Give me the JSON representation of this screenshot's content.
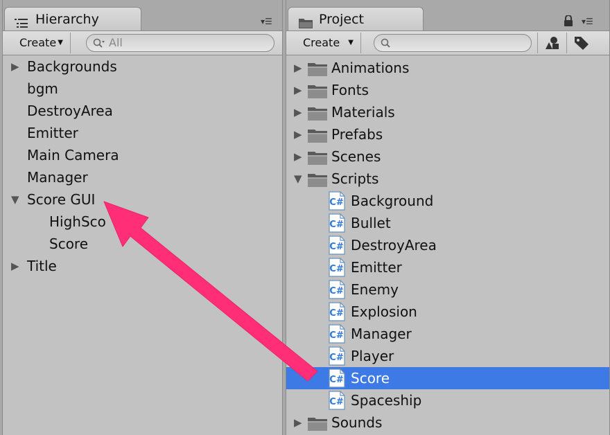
{
  "colors": {
    "selection": "#3e7ae6",
    "arrow": "#ff2e76",
    "panel": "#c2c2c2"
  },
  "hierarchy": {
    "tab_label": "Hierarchy",
    "create_label": "Create",
    "search_placeholder": "All",
    "items": [
      {
        "label": "Backgrounds",
        "expander": "collapsed"
      },
      {
        "label": "bgm",
        "expander": "none"
      },
      {
        "label": "DestroyArea",
        "expander": "none"
      },
      {
        "label": "Emitter",
        "expander": "none"
      },
      {
        "label": "Main Camera",
        "expander": "none"
      },
      {
        "label": "Manager",
        "expander": "none"
      },
      {
        "label": "Score GUI",
        "expander": "expanded"
      },
      {
        "label": "HighSco",
        "expander": "none"
      },
      {
        "label": "Score",
        "expander": "none"
      },
      {
        "label": "Title",
        "expander": "collapsed"
      }
    ]
  },
  "project": {
    "tab_label": "Project",
    "create_label": "Create",
    "search_placeholder": "",
    "folders_top": [
      "Animations",
      "Fonts",
      "Materials",
      "Prefabs",
      "Scenes"
    ],
    "scripts_folder": "Scripts",
    "scripts": [
      "Background",
      "Bullet",
      "DestroyArea",
      "Emitter",
      "Enemy",
      "Explosion",
      "Manager",
      "Player",
      "Score",
      "Spaceship"
    ],
    "selected_script": "Score",
    "folders_bottom": [
      "Sounds"
    ]
  },
  "icons": {
    "hierarchy_tab": "list-icon",
    "project_tab": "folder-icon",
    "search": "search-icon",
    "lock": "lock-icon",
    "panel_menu": "panel-menu-icon",
    "filter_by_type": "shapes-icon",
    "filter_by_label": "tag-icon",
    "script": "csharp-script-icon",
    "folder": "folder-icon"
  },
  "annotation": {
    "description": "drag arrow from Score script to Score GUI"
  }
}
